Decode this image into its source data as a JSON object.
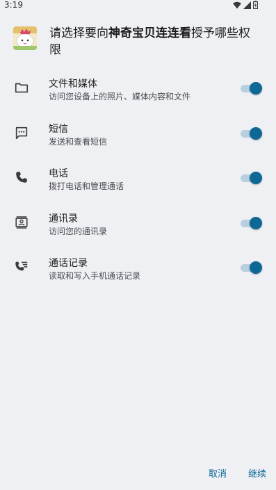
{
  "statusbar": {
    "time": "3:19"
  },
  "header": {
    "prefix": "请选择要向",
    "app_name": "神奇宝贝连连看",
    "suffix": "授予哪些权限"
  },
  "permissions": [
    {
      "icon": "folder-icon",
      "title": "文件和媒体",
      "desc": "访问您设备上的照片、媒体内容和文件",
      "enabled": true
    },
    {
      "icon": "sms-icon",
      "title": "短信",
      "desc": "发送和查看短信",
      "enabled": true
    },
    {
      "icon": "phone-icon",
      "title": "电话",
      "desc": "拨打电话和管理通话",
      "enabled": true
    },
    {
      "icon": "contacts-icon",
      "title": "通讯录",
      "desc": "访问您的通讯录",
      "enabled": true
    },
    {
      "icon": "call-log-icon",
      "title": "通话记录",
      "desc": "读取和写入手机通话记录",
      "enabled": true
    }
  ],
  "buttons": {
    "cancel": "取消",
    "continue": "继续"
  },
  "colors": {
    "accent": "#0d6896",
    "track": "#b7cfdf",
    "background": "#eff0f4"
  }
}
